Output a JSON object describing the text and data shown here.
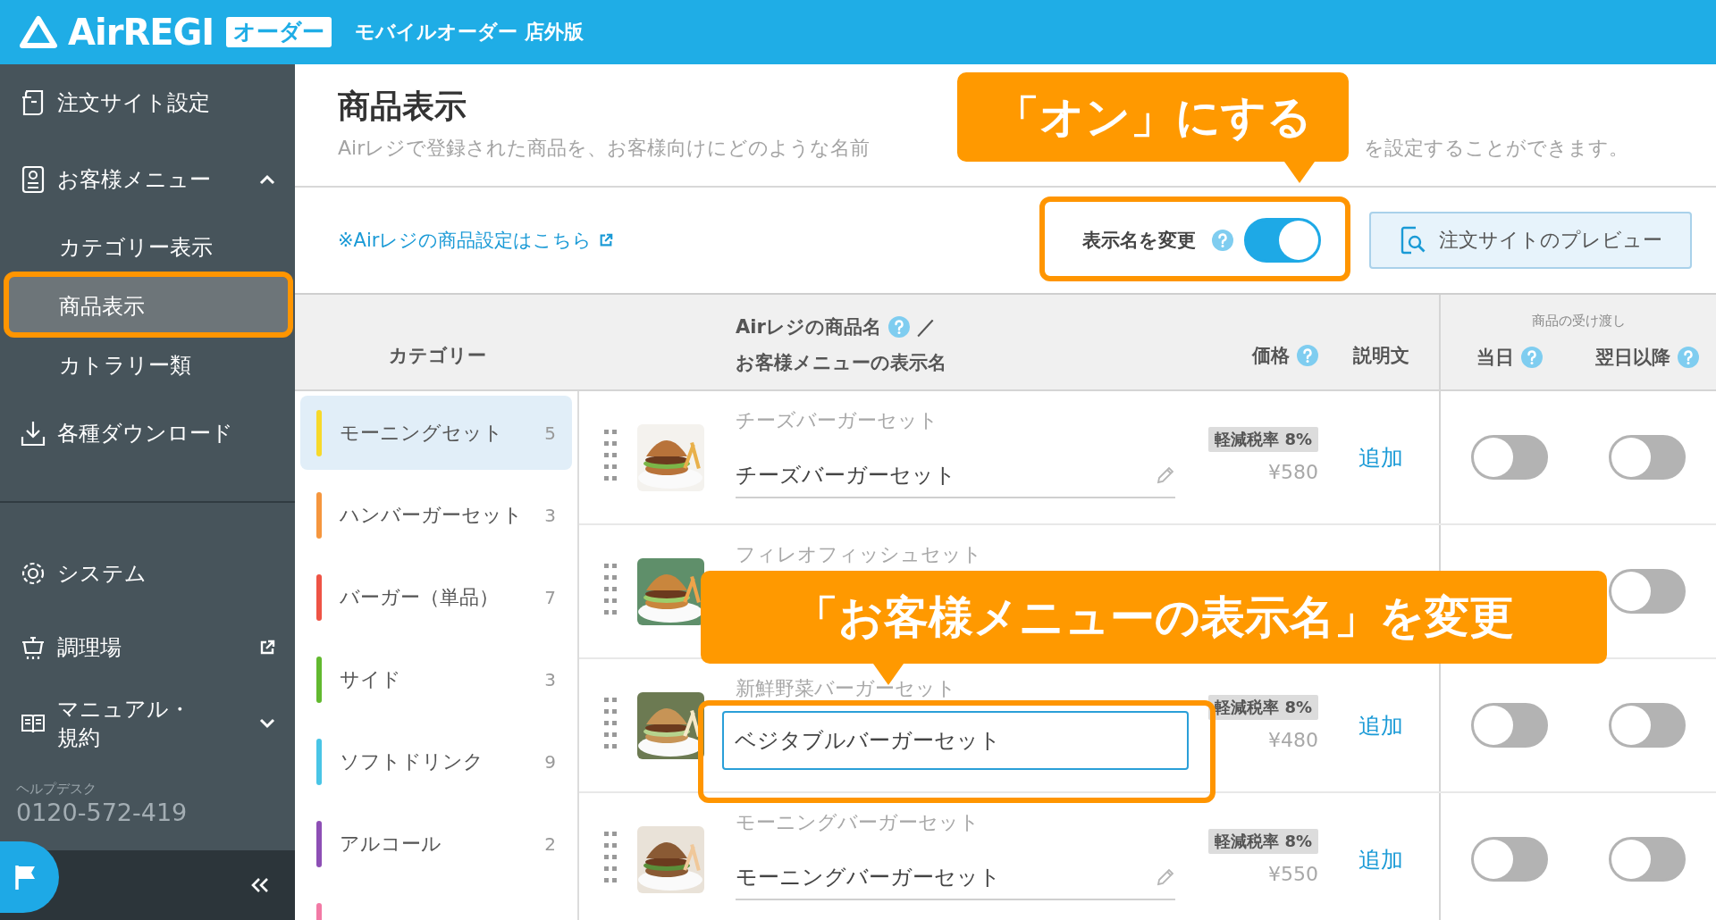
{
  "header": {
    "logo": "AirREGI",
    "badge": "オーダー",
    "subtitle": "モバイルオーダー 店外版"
  },
  "sidebar": {
    "items": [
      {
        "label": "注文サイト設定"
      },
      {
        "label": "お客様メニュー",
        "expanded": true,
        "children": [
          {
            "label": "カテゴリー表示",
            "selected": false
          },
          {
            "label": "商品表示",
            "selected": true
          },
          {
            "label": "カトラリー類",
            "selected": false
          }
        ]
      },
      {
        "label": "各種ダウンロード"
      }
    ],
    "system_items": [
      {
        "label": "システム"
      },
      {
        "label": "調理場",
        "external": true
      },
      {
        "label": "マニュアル・規約",
        "expanded": false
      }
    ],
    "helpdesk": {
      "label": "ヘルプデスク",
      "phone": "0120-572-419"
    }
  },
  "page": {
    "title": "商品表示",
    "description": [
      "Airレジで登録された商品を、お客様向けにどのような名前",
      "を設定することができます。"
    ],
    "settings_link": "※Airレジの商品設定はこちら",
    "rename_toggle": {
      "label": "表示名を変更",
      "on": true
    },
    "preview_button": "注文サイトのプレビュー"
  },
  "table": {
    "columns": {
      "category": "カテゴリー",
      "product_name": "Airレジの商品名",
      "slash": "／",
      "display_name": "お客様メニューの表示名",
      "price": "価格",
      "description": "説明文",
      "handover": "商品の受け渡し",
      "same_day": "当日",
      "next_day": "翌日以降"
    },
    "categories": [
      {
        "name": "モーニングセット",
        "count": "5",
        "color": "#f7d92a",
        "selected": true
      },
      {
        "name": "ハンバーガーセット",
        "count": "3",
        "color": "#f5963e",
        "selected": false
      },
      {
        "name": "バーガー（単品）",
        "count": "7",
        "color": "#ee5345",
        "selected": false
      },
      {
        "name": "サイド",
        "count": "3",
        "color": "#62b92f",
        "selected": false
      },
      {
        "name": "ソフトドリンク",
        "count": "9",
        "color": "#49c5e6",
        "selected": false
      },
      {
        "name": "アルコール",
        "count": "2",
        "color": "#8d4fb5",
        "selected": false
      },
      {
        "color": "#f27aa5",
        "selected": false
      }
    ],
    "products": [
      {
        "airregi_name": "チーズバーガーセット",
        "display_name": "チーズバーガーセット",
        "editing": false,
        "tax_badge": "軽減税率 8%",
        "price": "¥580",
        "description_action": "追加",
        "same_day": false,
        "next_day": false
      },
      {
        "airregi_name": "フィレオフィッシュセット",
        "next_day": false
      },
      {
        "airregi_name": "新鮮野菜バーガーセット",
        "display_name": "ベジタブルバーガーセット",
        "editing": true,
        "tax_badge": "軽減税率 8%",
        "price": "¥480",
        "description_action": "追加",
        "same_day": false,
        "next_day": false
      },
      {
        "airregi_name": "モーニングバーガーセット",
        "display_name": "モーニングバーガーセット",
        "editing": false,
        "tax_badge": "軽減税率 8%",
        "price": "¥550",
        "description_action": "追加",
        "same_day": false,
        "next_day": false
      }
    ]
  },
  "annotations": [
    {
      "text": "「オン」にする"
    },
    {
      "text": "「お客様メニューの表示名」を変更"
    }
  ]
}
